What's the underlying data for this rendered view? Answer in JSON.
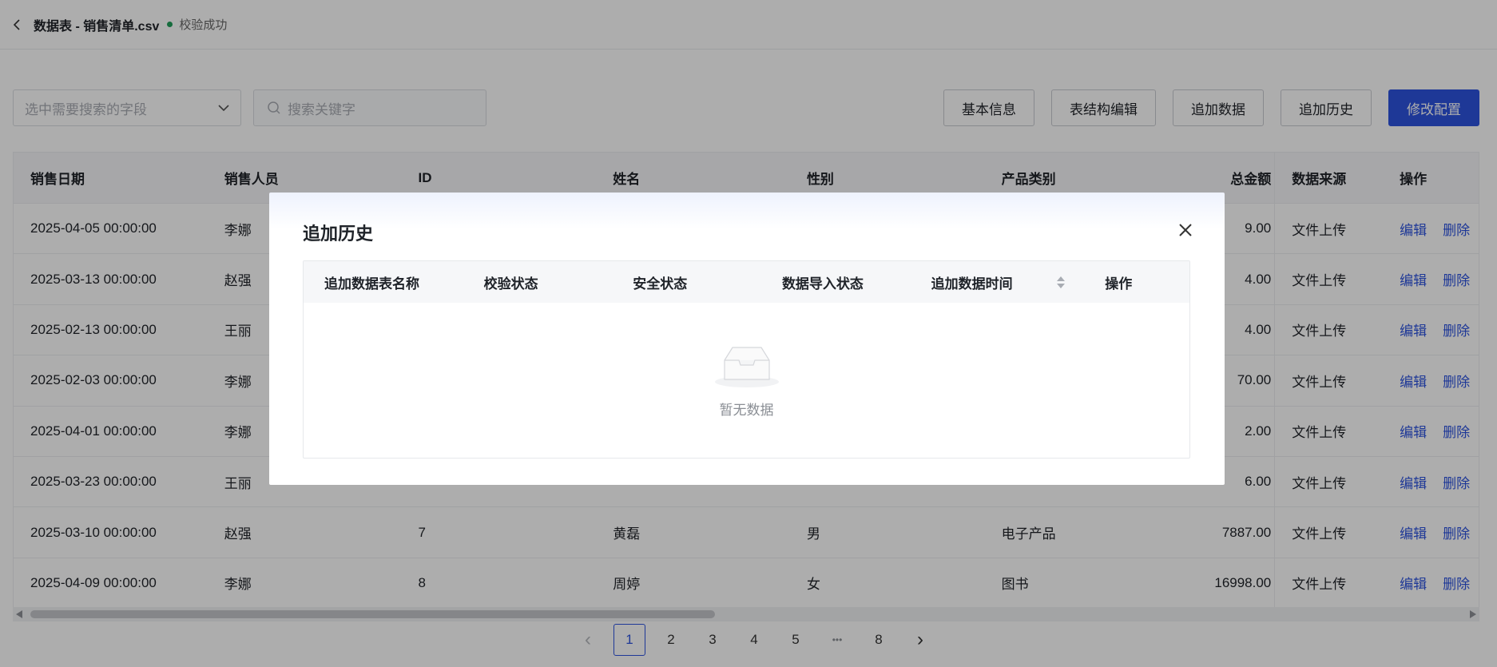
{
  "header": {
    "title": "数据表 - 销售清单.csv",
    "status_text": "校验成功",
    "status_color": "#21a05a"
  },
  "toolbar": {
    "field_select_placeholder": "选中需要搜索的字段",
    "search_placeholder": "搜索关键字",
    "buttons": [
      "基本信息",
      "表结构编辑",
      "追加数据",
      "追加历史",
      "修改配置"
    ]
  },
  "table": {
    "columns": [
      "销售日期",
      "销售人员",
      "ID",
      "姓名",
      "性别",
      "产品类别",
      "总金额",
      "数据来源",
      "操作"
    ],
    "rows": [
      {
        "date": "2025-04-05 00:00:00",
        "seller": "李娜",
        "id": "",
        "name": "",
        "gender": "",
        "category": "",
        "total": "9.00",
        "source": "文件上传"
      },
      {
        "date": "2025-03-13 00:00:00",
        "seller": "赵强",
        "id": "",
        "name": "",
        "gender": "",
        "category": "",
        "total": "4.00",
        "source": "文件上传"
      },
      {
        "date": "2025-02-13 00:00:00",
        "seller": "王丽",
        "id": "",
        "name": "",
        "gender": "",
        "category": "",
        "total": "4.00",
        "source": "文件上传"
      },
      {
        "date": "2025-02-03 00:00:00",
        "seller": "李娜",
        "id": "",
        "name": "",
        "gender": "",
        "category": "",
        "total": "70.00",
        "source": "文件上传"
      },
      {
        "date": "2025-04-01 00:00:00",
        "seller": "李娜",
        "id": "",
        "name": "",
        "gender": "",
        "category": "",
        "total": "2.00",
        "source": "文件上传"
      },
      {
        "date": "2025-03-23 00:00:00",
        "seller": "王丽",
        "id": "",
        "name": "",
        "gender": "",
        "category": "",
        "total": "6.00",
        "source": "文件上传"
      },
      {
        "date": "2025-03-10 00:00:00",
        "seller": "赵强",
        "id": "7",
        "name": "黄磊",
        "gender": "男",
        "category": "电子产品",
        "total": "7887.00",
        "source": "文件上传"
      },
      {
        "date": "2025-04-09 00:00:00",
        "seller": "李娜",
        "id": "8",
        "name": "周婷",
        "gender": "女",
        "category": "图书",
        "total": "16998.00",
        "source": "文件上传"
      }
    ],
    "action_edit": "编辑",
    "action_delete": "删除"
  },
  "pagination": {
    "prev": "‹",
    "pages": [
      "1",
      "2",
      "3",
      "4",
      "5",
      "•••",
      "8"
    ],
    "current": "1",
    "next": "›"
  },
  "modal": {
    "title": "追加历史",
    "columns": [
      "追加数据表名称",
      "校验状态",
      "安全状态",
      "数据导入状态",
      "追加数据时间",
      "操作"
    ],
    "empty_text": "暂无数据"
  },
  "colors": {
    "primary": "#2d53df",
    "success": "#21a05a"
  }
}
